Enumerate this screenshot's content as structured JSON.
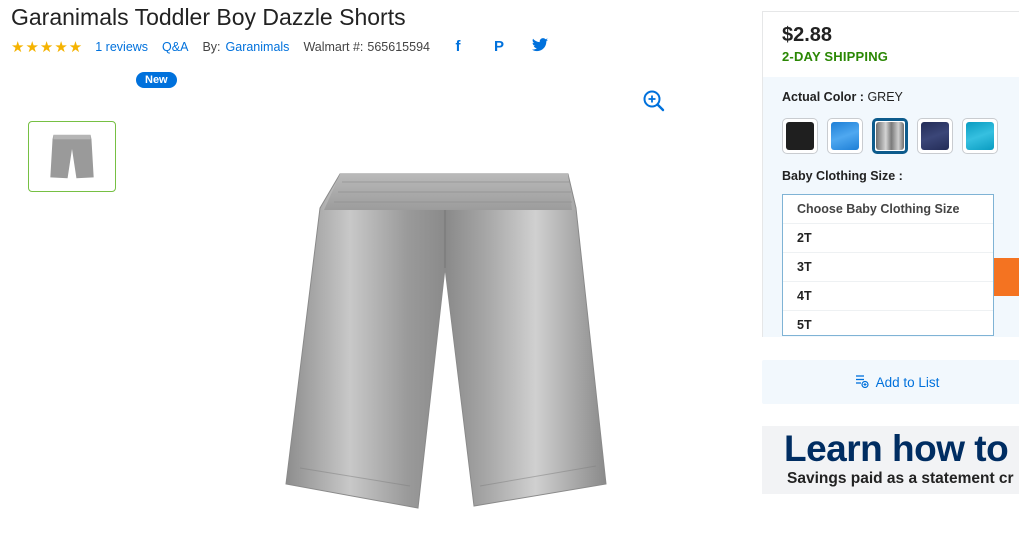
{
  "product": {
    "title": "Garanimals Toddler Boy Dazzle Shorts",
    "rating_stars": "★★★★★",
    "reviews_label": "1 reviews",
    "qa_label": "Q&A",
    "by_label": "By:",
    "brand": "Garanimals",
    "walmart_label": "Walmart #:",
    "walmart_number": "565615594",
    "badge": "New"
  },
  "social": {
    "facebook": "f",
    "pinterest": "P",
    "twitter": "t"
  },
  "buybox": {
    "price": "$2.88",
    "shipping": "2-DAY SHIPPING",
    "color_label": "Actual Color :",
    "color_value": "GREY",
    "swatches": [
      {
        "name": "black",
        "color": "#1f1f1f"
      },
      {
        "name": "blue",
        "color": "#2a8fe3"
      },
      {
        "name": "grey",
        "color": "#8e8e8e",
        "selected": true
      },
      {
        "name": "navy",
        "color": "#2b3564"
      },
      {
        "name": "teal",
        "color": "#14a6c9"
      }
    ],
    "size_label": "Baby Clothing Size :",
    "size_options": [
      "Choose Baby Clothing Size",
      "2T",
      "3T",
      "4T",
      "5T"
    ]
  },
  "add_to_list": "Add to List",
  "promo": {
    "title": "Learn how to s",
    "subtitle": "Savings paid as a statement cr"
  },
  "colors": {
    "accent": "#0071dc",
    "shipping_green": "#2a8703",
    "star": "#f5b301",
    "cta_orange": "#f47321"
  },
  "icons": [
    "zoom-in-icon",
    "facebook-icon",
    "pinterest-icon",
    "twitter-icon",
    "add-to-list-icon"
  ]
}
